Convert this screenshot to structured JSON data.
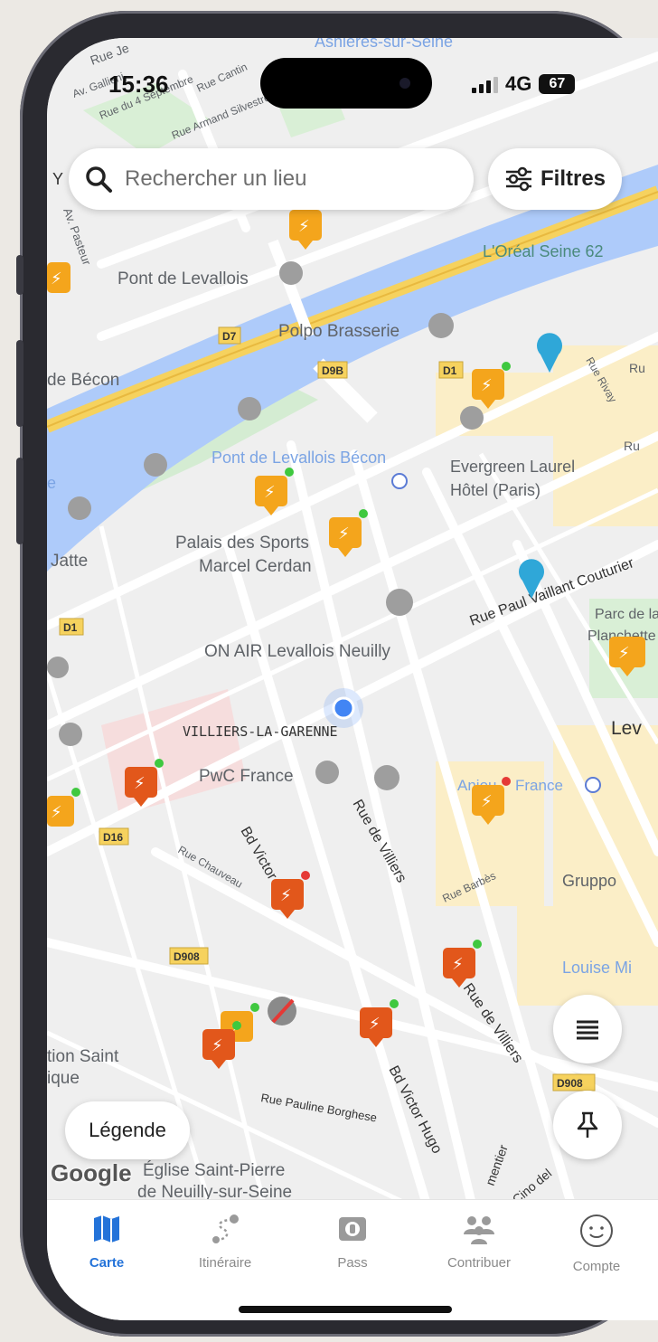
{
  "status": {
    "time": "15:36",
    "network": "4G",
    "battery": "67"
  },
  "search": {
    "placeholder": "Rechercher un lieu"
  },
  "filters": {
    "label": "Filtres"
  },
  "map": {
    "labels": {
      "rue_je": "Rue Je",
      "av_gallieni": "Av. Gallieni",
      "rue_du_4_sept": "Rue du 4 Septembre",
      "rue_cantin": "Rue Cantin",
      "rue_armand_silvestre": "Rue Armand Silvestre",
      "asnieres": "Asnières-sur-Seine",
      "y": "Y",
      "av_pasteur": "Av. Pasteur",
      "pont_levallois": "Pont de Levallois",
      "loreal": "L'Oréal Seine 62",
      "d7": "D7",
      "polpo": "Polpo Brasserie",
      "de_becon": "de Bécon",
      "d9b": "D9B",
      "d1_top": "D1",
      "rue_rivay": "Rue Rivay",
      "ru1": "Ru",
      "ru2": "Ru",
      "pont_levallois_becon": "Pont de Levallois Bécon",
      "evergreen": "Evergreen Laurel",
      "hotel_paris": "Hôtel (Paris)",
      "e": "e",
      "palais_sports": "Palais des Sports",
      "marcel_cerdan": "Marcel Cerdan",
      "jatte": "Jatte",
      "rue_paul_vaillant": "Rue Paul Vaillant Couturier",
      "parc": "Parc de la",
      "planchette": "Planchette",
      "d1_left": "D1",
      "on_air": "ON AIR Levallois Neuilly",
      "lev": "Lev",
      "villiers": "VILLIERS-LA-GARENNE",
      "pwc": "PwC France",
      "anjou": "Anjou",
      "france_m": "France",
      "d16": "D16",
      "rue_chauveau": "Rue Chauveau",
      "bd_victor_hugo_1": "Bd Victor Hugo",
      "rue_de_villiers_1": "Rue de Villiers",
      "rue_barbes": "Rue Barbès",
      "gruppo": "Gruppo",
      "d908_1": "D908",
      "louise_mi": "Louise Mi",
      "rue_de_villiers_2": "Rue de Villiers",
      "tion_saint": "tion Saint",
      "ique": "ique",
      "d908_2": "D908",
      "rue_pauline": "Rue Pauline Borghese",
      "bd_victor_hugo_2": "Bd Victor Hugo",
      "mentier": "mentier",
      "cino_del": "Cino del",
      "eglise": "Église Saint-Pierre",
      "de_neuilly": "de Neuilly-sur-Seine"
    }
  },
  "legend": {
    "label": "Légende"
  },
  "google": {
    "label": "Google"
  },
  "tabs": [
    {
      "label": "Carte",
      "icon": "map-icon"
    },
    {
      "label": "Itinéraire",
      "icon": "route-icon"
    },
    {
      "label": "Pass",
      "icon": "pass-icon"
    },
    {
      "label": "Contribuer",
      "icon": "community-icon"
    },
    {
      "label": "Compte",
      "icon": "smiley-icon"
    }
  ],
  "colors": {
    "accent": "#2473d9",
    "charger_orange": "#f4a51c",
    "charger_red": "#e2571b",
    "river": "#aecbfa",
    "park": "#d4ecd2",
    "road_yellow": "#f6d25e",
    "status_green": "#3fc83f",
    "status_red": "#e53935"
  }
}
